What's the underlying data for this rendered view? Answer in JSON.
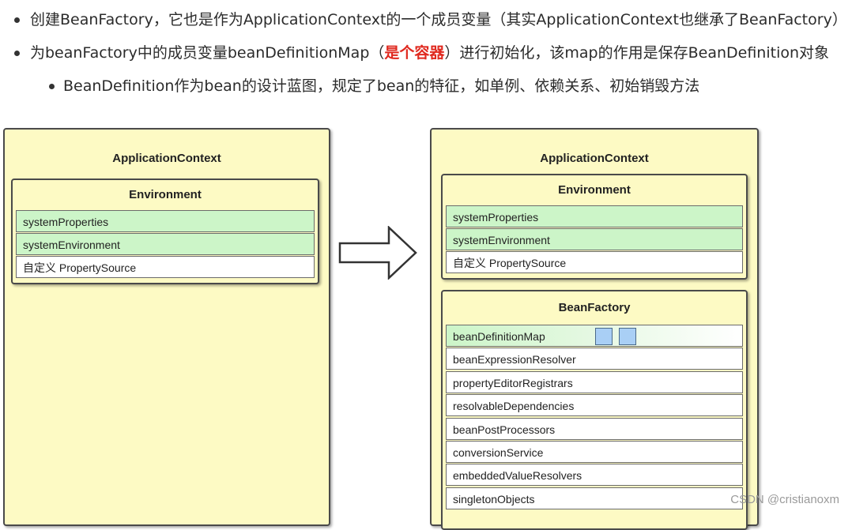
{
  "bullets": [
    {
      "text": "创建BeanFactory，它也是作为ApplicationContext的一个成员变量（其实ApplicationContext也继承了BeanFactory）"
    },
    {
      "text_before": "为beanFactory中的成员变量beanDefinitionMap（",
      "highlight": "是个容器",
      "text_after": "）进行初始化，该map的作用是保存BeanDefinition对象"
    },
    {
      "text": "BeanDefinition作为bean的设计蓝图，规定了bean的特征，如单例、依赖关系、初始销毁方法"
    }
  ],
  "left_panel": {
    "title": "ApplicationContext",
    "environment": {
      "title": "Environment",
      "rows": [
        "systemProperties",
        "systemEnvironment",
        "自定义 PropertySource"
      ]
    }
  },
  "right_panel": {
    "title": "ApplicationContext",
    "environment": {
      "title": "Environment",
      "rows": [
        "systemProperties",
        "systemEnvironment",
        "自定义 PropertySource"
      ]
    },
    "bean_factory": {
      "title": "BeanFactory",
      "rows": [
        "beanDefinitionMap",
        "beanExpressionResolver",
        "propertyEditorRegistrars",
        "resolvableDependencies",
        "beanPostProcessors",
        "conversionService",
        "embeddedValueResolvers",
        "singletonObjects"
      ]
    }
  },
  "colors": {
    "highlight": "#e0291f",
    "panel_fill": "#fdfac4",
    "row_green": "#ccf5c8",
    "map_square": "#a9cff5"
  },
  "watermark": "CSDN @cristianoxm"
}
